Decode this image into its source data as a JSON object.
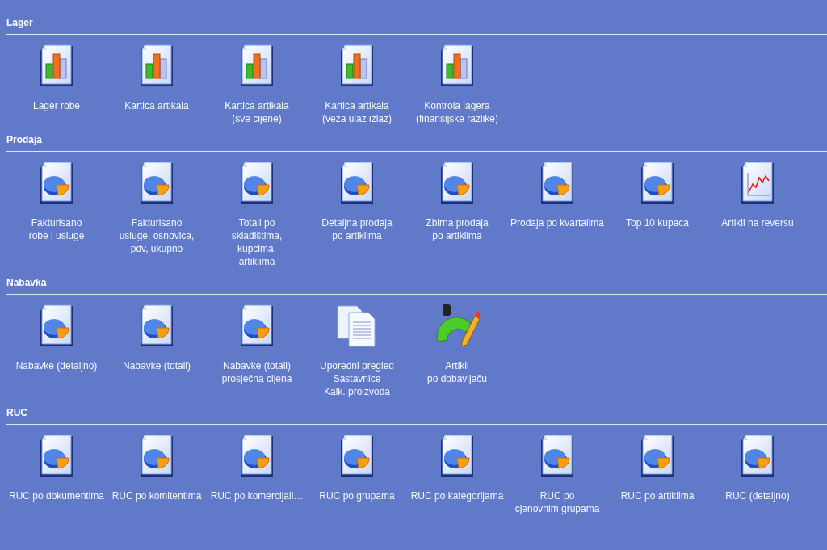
{
  "sections": [
    {
      "title": "Lager",
      "items": [
        {
          "kind": "bars",
          "label": "Lager robe"
        },
        {
          "kind": "bars",
          "label": "Kartica artikala"
        },
        {
          "kind": "bars",
          "label": "Kartica artikala\n(sve cijene)"
        },
        {
          "kind": "bars",
          "label": "Kartica artikala\n(veza ulaz izlaz)"
        },
        {
          "kind": "bars",
          "label": "Kontrola lagera\n(finansijske razlike)"
        }
      ]
    },
    {
      "title": "Prodaja",
      "items": [
        {
          "kind": "pie",
          "label": "Fakturisano\nrobe i usluge"
        },
        {
          "kind": "pie",
          "label": "Fakturisano\nusluge, osnovica,\npdv, ukupno"
        },
        {
          "kind": "pie",
          "label": "Totali po\nskladištima,\nkupcima,\nartiklima"
        },
        {
          "kind": "pie",
          "label": "Detaljna prodaja\npo artiklima"
        },
        {
          "kind": "pie",
          "label": "Zbirna prodaja\npo artiklima"
        },
        {
          "kind": "pie",
          "label": "Prodaja po kvartalima"
        },
        {
          "kind": "pie",
          "label": "Top 10 kupaca"
        },
        {
          "kind": "line",
          "label": "Artikli na reversu"
        }
      ]
    },
    {
      "title": "Nabavka",
      "items": [
        {
          "kind": "pie",
          "label": "Nabavke (detaljno)"
        },
        {
          "kind": "pie",
          "label": "Nabavke (totali)"
        },
        {
          "kind": "pie",
          "label": "Nabavke (totali)\nprosječna cijena"
        },
        {
          "kind": "docs",
          "label": "Uporedni pregled\nSastavnice\nKalk. proizvoda"
        },
        {
          "kind": "tools",
          "label": "Artikli\npo dobavljaču"
        }
      ]
    },
    {
      "title": "RUC",
      "items": [
        {
          "kind": "pie",
          "label": "RUC po dokumentima"
        },
        {
          "kind": "pie",
          "label": "RUC po komitentima"
        },
        {
          "kind": "pie",
          "label": "RUC po komercijali…"
        },
        {
          "kind": "pie",
          "label": "RUC po grupama"
        },
        {
          "kind": "pie",
          "label": "RUC po kategorijama"
        },
        {
          "kind": "pie",
          "label": "RUC po\ncjenovnim grupama"
        },
        {
          "kind": "pie",
          "label": "RUC po artiklima"
        },
        {
          "kind": "pie",
          "label": "RUC (detaljno)"
        }
      ]
    }
  ]
}
